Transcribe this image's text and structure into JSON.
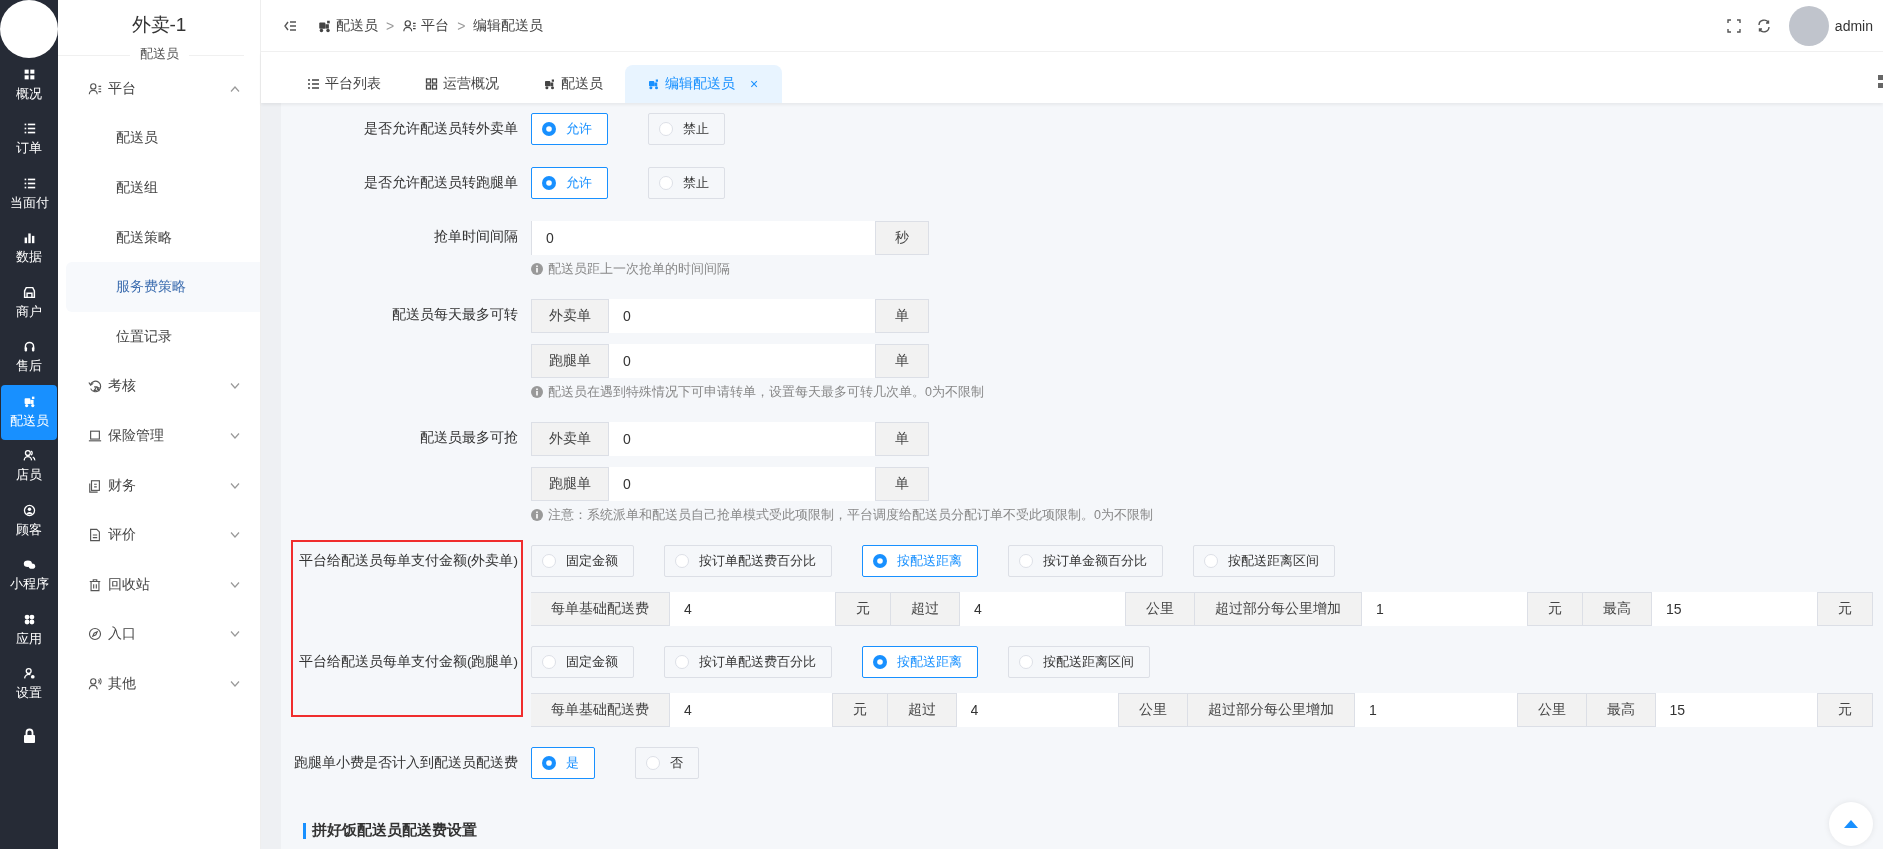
{
  "rail": {
    "items": [
      {
        "label": "概况",
        "selected": false
      },
      {
        "label": "订单",
        "selected": false
      },
      {
        "label": "当面付",
        "selected": false
      },
      {
        "label": "数据",
        "selected": false
      },
      {
        "label": "商户",
        "selected": false
      },
      {
        "label": "售后",
        "selected": false
      },
      {
        "label": "配送员",
        "selected": true
      },
      {
        "label": "店员",
        "selected": false
      },
      {
        "label": "顾客",
        "selected": false
      },
      {
        "label": "小程序",
        "selected": false
      },
      {
        "label": "应用",
        "selected": false
      },
      {
        "label": "设置",
        "selected": false
      }
    ]
  },
  "sidebar": {
    "title": "外卖-1",
    "subtitle": "配送员",
    "menu": [
      {
        "label": "平台",
        "expanded": true,
        "children": [
          {
            "label": "配送员",
            "selected": false
          },
          {
            "label": "配送组",
            "selected": false
          },
          {
            "label": "配送策略",
            "selected": false
          },
          {
            "label": "服务费策略",
            "selected": true
          },
          {
            "label": "位置记录",
            "selected": false
          }
        ]
      },
      {
        "label": "考核",
        "expanded": false
      },
      {
        "label": "保险管理",
        "expanded": false
      },
      {
        "label": "财务",
        "expanded": false
      },
      {
        "label": "评价",
        "expanded": false
      },
      {
        "label": "回收站",
        "expanded": false
      },
      {
        "label": "入口",
        "expanded": false
      },
      {
        "label": "其他",
        "expanded": false
      }
    ]
  },
  "header": {
    "breadcrumbs": [
      "配送员",
      "平台",
      "编辑配送员"
    ],
    "separator": ">",
    "user": "admin"
  },
  "tabs": [
    {
      "label": "平台列表",
      "selected": false
    },
    {
      "label": "运营概况",
      "selected": false
    },
    {
      "label": "配送员",
      "selected": false
    },
    {
      "label": "编辑配送员",
      "selected": true,
      "close": "×"
    }
  ],
  "form": {
    "rows": [
      {
        "kind": "radio",
        "label": "是否允许配送员转外卖单",
        "options": [
          {
            "label": "允许",
            "selected": true
          },
          {
            "label": "禁止",
            "selected": false
          }
        ]
      },
      {
        "kind": "radio",
        "label": "是否允许配送员转跑腿单",
        "options": [
          {
            "label": "允许",
            "selected": true
          },
          {
            "label": "禁止",
            "selected": false
          }
        ]
      },
      {
        "kind": "inputs",
        "label": "抢单时间间隔",
        "inputs": [
          {
            "value": "0",
            "suffix": "秒"
          }
        ],
        "hint": "配送员距上一次抢单的时间间隔"
      },
      {
        "kind": "inputs",
        "label": "配送员每天最多可转",
        "inputs": [
          {
            "prefix": "外卖单",
            "value": "0",
            "suffix": "单"
          },
          {
            "prefix": "跑腿单",
            "value": "0",
            "suffix": "单"
          }
        ],
        "hint": "配送员在遇到特殊情况下可申请转单，设置每天最多可转几次单。0为不限制"
      },
      {
        "kind": "inputs",
        "label": "配送员最多可抢",
        "inputs": [
          {
            "prefix": "外卖单",
            "value": "0",
            "suffix": "单"
          },
          {
            "prefix": "跑腿单",
            "value": "0",
            "suffix": "单"
          }
        ],
        "hint": "注意：系统派单和配送员自己抢单模式受此项限制，平台调度给配送员分配订单不受此项限制。0为不限制"
      },
      {
        "kind": "payment",
        "highlighted": true,
        "groups": [
          {
            "label": "平台给配送员每单支付金额(外卖单)",
            "options": [
              {
                "label": "固定金额",
                "selected": false
              },
              {
                "label": "按订单配送费百分比",
                "selected": false
              },
              {
                "label": "按配送距离",
                "selected": true
              },
              {
                "label": "按订单金额百分比",
                "selected": false
              },
              {
                "label": "按配送距离区间",
                "selected": false
              }
            ],
            "params": [
              {
                "kind": "addon",
                "text": "每单基础配送费"
              },
              {
                "kind": "input",
                "value": "4"
              },
              {
                "kind": "addon",
                "text": "元"
              },
              {
                "kind": "addon",
                "text": "超过"
              },
              {
                "kind": "input",
                "value": "4"
              },
              {
                "kind": "addon",
                "text": "公里"
              },
              {
                "kind": "addon",
                "text": "超过部分每公里增加"
              },
              {
                "kind": "input",
                "value": "1"
              },
              {
                "kind": "addon",
                "text": "元"
              },
              {
                "kind": "addon",
                "text": "最高"
              },
              {
                "kind": "input",
                "value": "15"
              },
              {
                "kind": "addon",
                "text": "元"
              }
            ]
          },
          {
            "label": "平台给配送员每单支付金额(跑腿单)",
            "options": [
              {
                "label": "固定金额",
                "selected": false
              },
              {
                "label": "按订单配送费百分比",
                "selected": false
              },
              {
                "label": "按配送距离",
                "selected": true
              },
              {
                "label": "按配送距离区间",
                "selected": false
              }
            ],
            "params": [
              {
                "kind": "addon",
                "text": "每单基础配送费"
              },
              {
                "kind": "input",
                "value": "4"
              },
              {
                "kind": "addon",
                "text": "元"
              },
              {
                "kind": "addon",
                "text": "超过"
              },
              {
                "kind": "input",
                "value": "4"
              },
              {
                "kind": "addon",
                "text": "公里"
              },
              {
                "kind": "addon",
                "text": "超过部分每公里增加"
              },
              {
                "kind": "input",
                "value": "1"
              },
              {
                "kind": "addon",
                "text": "公里"
              },
              {
                "kind": "addon",
                "text": "最高"
              },
              {
                "kind": "input",
                "value": "15"
              },
              {
                "kind": "addon",
                "text": "元"
              }
            ]
          }
        ]
      },
      {
        "kind": "radio",
        "label": "跑腿单小费是否计入到配送员配送费",
        "options": [
          {
            "label": "是",
            "selected": true
          },
          {
            "label": "否",
            "selected": false
          }
        ]
      }
    ],
    "section_title": "拼好饭配送员配送费设置"
  }
}
